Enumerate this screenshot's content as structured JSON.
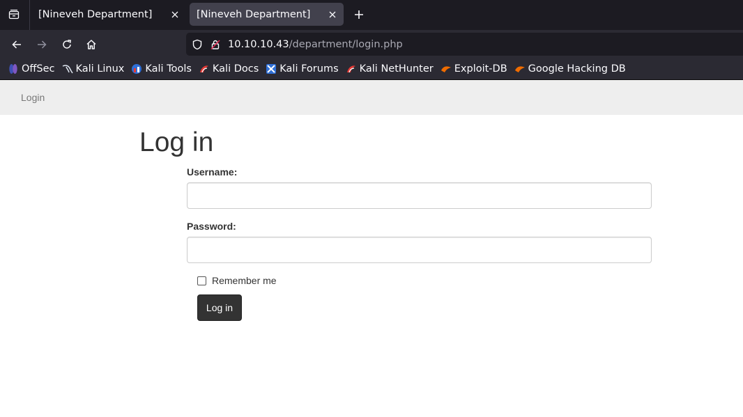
{
  "browser": {
    "tabs": [
      {
        "title": "[Nineveh Department]",
        "active": false
      },
      {
        "title": "[Nineveh Department]",
        "active": true
      }
    ],
    "url": {
      "host": "10.10.10.43",
      "path": "/department/login.php"
    },
    "bookmarks": [
      {
        "label": "OffSec",
        "icon": "offsec-icon",
        "color": "#5c6bc0"
      },
      {
        "label": "Kali Linux",
        "icon": "kali-dragon-icon",
        "color": "#cfd8e8"
      },
      {
        "label": "Kali Tools",
        "icon": "kali-tools-icon",
        "color": "#4a90d9"
      },
      {
        "label": "Kali Docs",
        "icon": "kali-docs-icon",
        "color": "#e53935"
      },
      {
        "label": "Kali Forums",
        "icon": "kali-forums-icon",
        "color": "#2f6fd6"
      },
      {
        "label": "Kali NetHunter",
        "icon": "kali-nethunter-icon",
        "color": "#e53935"
      },
      {
        "label": "Exploit-DB",
        "icon": "exploit-db-icon",
        "color": "#ef6c00"
      },
      {
        "label": "Google Hacking DB",
        "icon": "ghdb-icon",
        "color": "#ef6c00"
      }
    ]
  },
  "page": {
    "nav": {
      "login_link": "Login"
    },
    "heading": "Log in",
    "form": {
      "username_label": "Username:",
      "username_value": "",
      "password_label": "Password:",
      "password_value": "",
      "remember_label": "Remember me",
      "remember_checked": false,
      "submit_label": "Log in"
    }
  },
  "colors": {
    "tabbar_bg": "#1c1b22",
    "toolbar_bg": "#2b2a33",
    "active_tab_bg": "#42414d",
    "nav_bg": "#eeeeee",
    "button_bg": "#333333"
  }
}
